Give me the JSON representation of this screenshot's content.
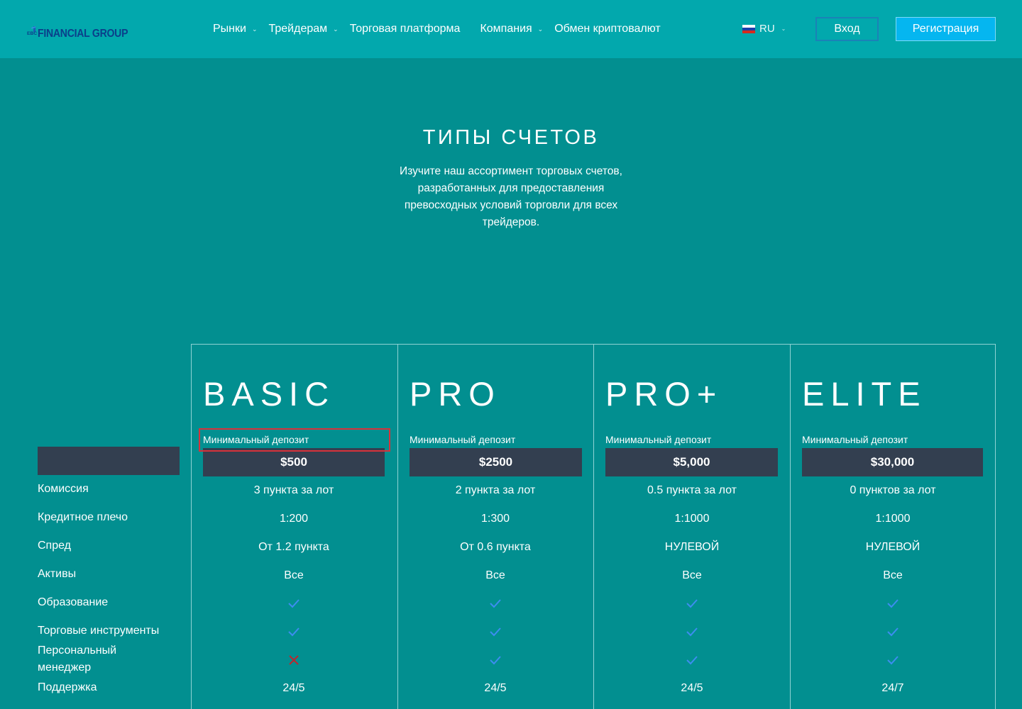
{
  "header": {
    "logo_text": "FINANCIAL GROUP",
    "nav": [
      {
        "label": "Рынки",
        "has_dropdown": true
      },
      {
        "label": "Трейдерам",
        "has_dropdown": true
      },
      {
        "label": "Торговая платформа",
        "has_dropdown": false
      },
      {
        "label": "Компания",
        "has_dropdown": true
      },
      {
        "label": "Обмен криптовалют",
        "has_dropdown": false
      }
    ],
    "language": "RU",
    "login_label": "Вход",
    "register_label": "Регистрация"
  },
  "hero": {
    "title": "ТИПЫ СЧЕТОВ",
    "description": "Изучите наш ассортимент торговых счетов, разработанных для предоставления превосходных условий торговли для всех трейдеров."
  },
  "table": {
    "row_labels": [
      "Комиссия",
      "Кредитное плечо",
      "Спред",
      "Активы",
      "Образование",
      "Торговые инструменты",
      "Персональный менеджер",
      "Поддержка"
    ],
    "min_deposit_label": "Минимальный депозит",
    "accounts": [
      {
        "name": "BASIC",
        "deposit": "$500",
        "commission": "3 пункта за лот",
        "leverage": "1:200",
        "spread": "От 1.2 пункта",
        "assets": "Все",
        "education": true,
        "instruments": true,
        "manager": false,
        "support": "24/5"
      },
      {
        "name": "PRO",
        "deposit": "$2500",
        "commission": "2 пункта за лот",
        "leverage": "1:300",
        "spread": "От 0.6 пункта",
        "assets": "Все",
        "education": true,
        "instruments": true,
        "manager": true,
        "support": "24/5"
      },
      {
        "name": "PRO+",
        "deposit": "$5,000",
        "commission": "0.5 пункта за лот",
        "leverage": "1:1000",
        "spread": "НУЛЕВОЙ",
        "assets": "Все",
        "education": true,
        "instruments": true,
        "manager": true,
        "support": "24/5"
      },
      {
        "name": "ELITE",
        "deposit": "$30,000",
        "commission": "0 пунктов за лот",
        "leverage": "1:1000",
        "spread": "НУЛЕВОЙ",
        "assets": "Все",
        "education": true,
        "instruments": true,
        "manager": true,
        "support": "24/7"
      }
    ]
  },
  "colors": {
    "page_bg": "#028f90",
    "header_bg": "#02a8ad",
    "dark_box": "#333f50",
    "register_bg": "#05b6f0",
    "check": "#3d8df0",
    "cross": "#c0242c",
    "highlight": "#d8323a"
  },
  "icons": {
    "included": "check-icon",
    "excluded": "cross-icon"
  }
}
